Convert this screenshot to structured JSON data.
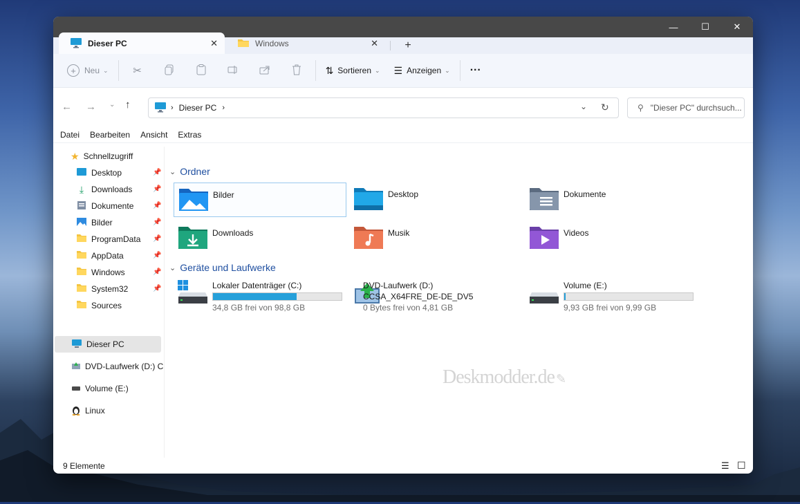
{
  "window": {
    "minimize_icon": "—",
    "maximize_icon": "☐",
    "close_icon": "✕"
  },
  "tabs": [
    {
      "label": "Dieser PC",
      "active": true
    },
    {
      "label": "Windows",
      "active": false
    }
  ],
  "new_tab_icon": "+",
  "toolbar": {
    "new_label": "Neu",
    "sort_label": "Sortieren",
    "view_label": "Anzeigen",
    "more_label": "···"
  },
  "nav": {
    "address_text": "Dieser PC",
    "search_placeholder": "\"Dieser PC\" durchsuch..."
  },
  "menu": [
    "Datei",
    "Bearbeiten",
    "Ansicht",
    "Extras"
  ],
  "sidebar": {
    "quick_access": "Schnellzugriff",
    "items": [
      "Desktop",
      "Downloads",
      "Dokumente",
      "Bilder",
      "ProgramData",
      "AppData",
      "Windows",
      "System32",
      "Sources"
    ],
    "this_pc": "Dieser PC",
    "dvd": "DVD-Laufwerk (D:) C",
    "volume": "Volume (E:)",
    "linux": "Linux"
  },
  "sections": {
    "folders_title": "Ordner",
    "drives_title": "Geräte und Laufwerke"
  },
  "folders": [
    "Bilder",
    "Desktop",
    "Dokumente",
    "Downloads",
    "Musik",
    "Videos"
  ],
  "drives": [
    {
      "label": "Lokaler Datenträger (C:)",
      "free": "34,8 GB frei von 98,8 GB",
      "used_fraction": 0.65
    },
    {
      "label": "DVD-Laufwerk (D:)",
      "sublabel": "CCSA_X64FRE_DE-DE_DV5",
      "free": "0 Bytes frei von 4,81 GB"
    },
    {
      "label": "Volume (E:)",
      "free": "9,93 GB frei von 9,99 GB",
      "used_fraction": 0.006
    }
  ],
  "watermark": "Deskmodder.de",
  "status": {
    "count": "9 Elemente"
  },
  "colors": {
    "accent": "#26a0da",
    "section_title": "#1f4fa0"
  }
}
